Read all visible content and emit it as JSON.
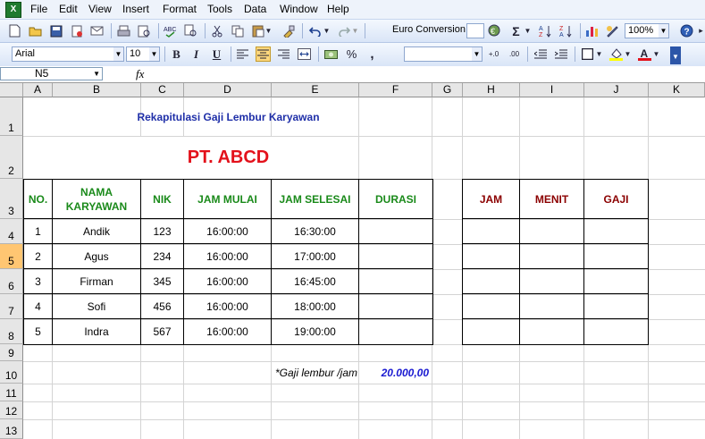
{
  "menu": [
    "File",
    "Edit",
    "View",
    "Insert",
    "Format",
    "Tools",
    "Data",
    "Window",
    "Help"
  ],
  "toolbar": {
    "euro_conversion": "Euro Conversion",
    "zoom": "100%",
    "font_name": "Arial",
    "font_size": "10",
    "bold": "B",
    "italic": "I",
    "underline": "U",
    "percent": "%",
    "comma": ",",
    "inc_decimal": "+.0",
    "dec_decimal": ".00"
  },
  "formula_bar": {
    "name_box": "N5",
    "fx": "fx"
  },
  "columns": [
    "A",
    "B",
    "C",
    "D",
    "E",
    "F",
    "G",
    "H",
    "I",
    "J",
    "K"
  ],
  "rows": [
    "1",
    "2",
    "3",
    "4",
    "5",
    "6",
    "7",
    "8",
    "9",
    "10",
    "11",
    "12",
    "13"
  ],
  "selected_row": "5",
  "sheet": {
    "title": "Rekapitulasi Gaji Lembur Karyawan",
    "company": "PT. ABCD",
    "headers": [
      "NO.",
      "NAMA KARYAWAN",
      "NIK",
      "JAM MULAI",
      "JAM SELESAI",
      "DURASI"
    ],
    "headers2": [
      "JAM",
      "MENIT",
      "GAJI"
    ],
    "data": [
      [
        "1",
        "Andik",
        "123",
        "16:00:00",
        "16:30:00"
      ],
      [
        "2",
        "Agus",
        "234",
        "16:00:00",
        "17:00:00"
      ],
      [
        "3",
        "Firman",
        "345",
        "16:00:00",
        "16:45:00"
      ],
      [
        "4",
        "Sofi",
        "456",
        "16:00:00",
        "18:00:00"
      ],
      [
        "5",
        "Indra",
        "567",
        "16:00:00",
        "19:00:00"
      ]
    ],
    "rate_label": "*Gaji lembur /jam",
    "rate_value": "20.000,00"
  },
  "colors": {
    "title_blue": "#1f2fa8",
    "company_red": "#e3111b",
    "header_green": "#1a8a1a",
    "header_darkred": "#8b0000",
    "rate_blue": "#1a1ad1",
    "selected_row": "#ffc672"
  }
}
